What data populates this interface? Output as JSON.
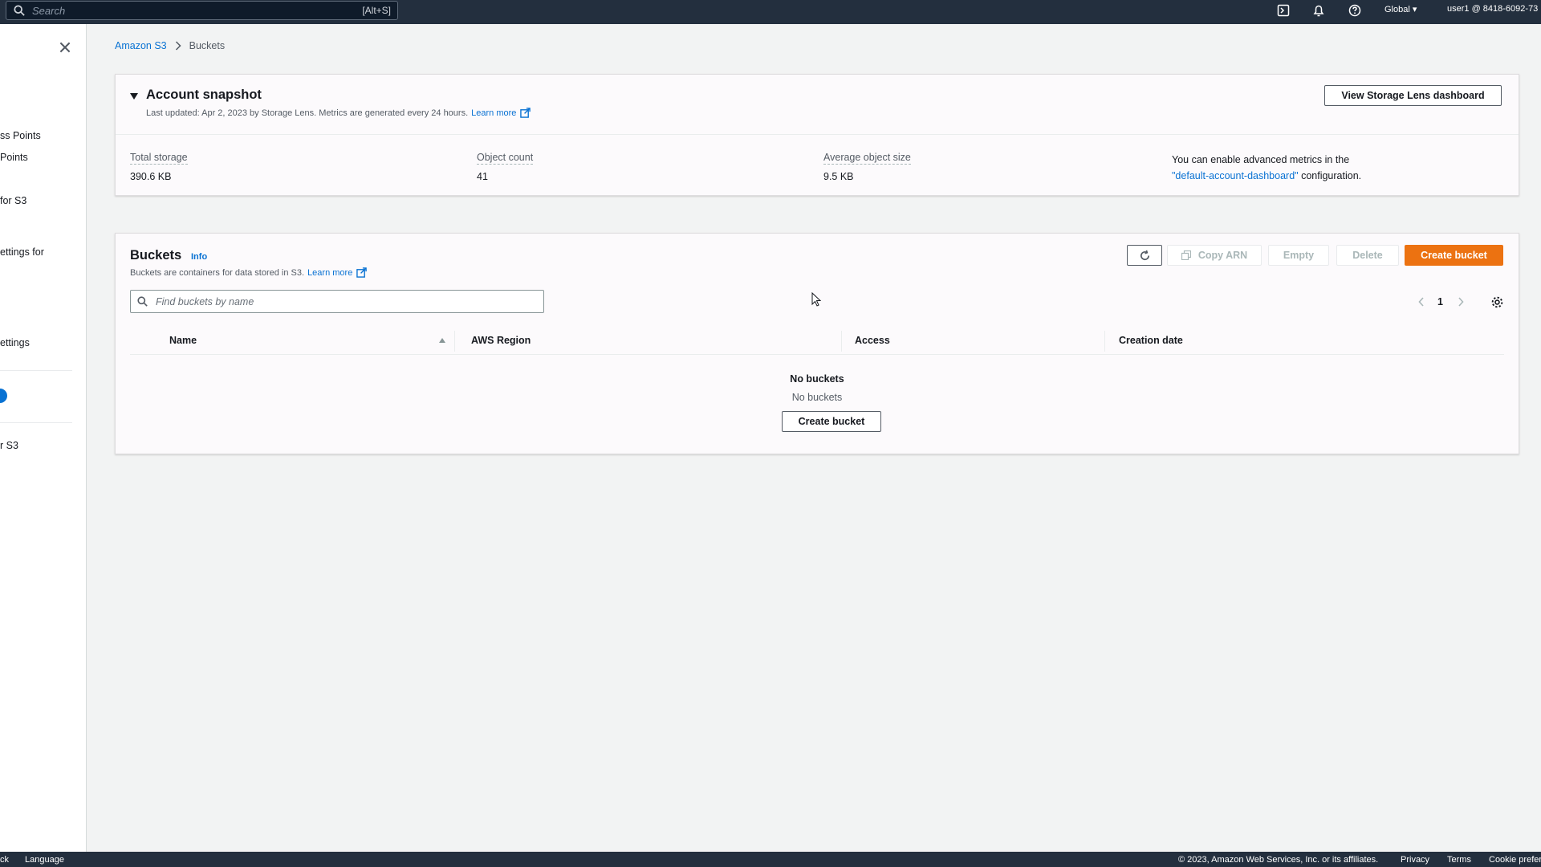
{
  "topnav": {
    "search_placeholder": "Search",
    "search_shortcut": "[Alt+S]",
    "region": "Global ▾",
    "user": "user1 @ 8418-6092-73"
  },
  "sidenav": {
    "items": [
      "ss Points",
      "Points",
      "for S3",
      "ettings for",
      "ettings",
      "r S3"
    ]
  },
  "breadcrumb": {
    "root": "Amazon S3",
    "current": "Buckets"
  },
  "snapshot": {
    "title": "Account snapshot",
    "subtitle": "Last updated: Apr 2, 2023 by Storage Lens. Metrics are generated every 24 hours.",
    "learn_more": "Learn more",
    "view_button": "View Storage Lens dashboard",
    "metrics": [
      {
        "label": "Total storage",
        "value": "390.6 KB"
      },
      {
        "label": "Object count",
        "value": "41"
      },
      {
        "label": "Average object size",
        "value": "9.5 KB"
      }
    ],
    "advanced_prefix": "You can enable advanced metrics in the",
    "advanced_link": "\"default-account-dashboard\"",
    "advanced_suffix": " configuration."
  },
  "buckets": {
    "title": "Buckets",
    "info": "Info",
    "subtitle": "Buckets are containers for data stored in S3.",
    "learn_more": "Learn more",
    "buttons": {
      "copy_arn": "Copy ARN",
      "empty": "Empty",
      "delete": "Delete",
      "create": "Create bucket"
    },
    "search_placeholder": "Find buckets by name",
    "page": "1",
    "columns": [
      "Name",
      "AWS Region",
      "Access",
      "Creation date"
    ],
    "empty_title": "No buckets",
    "empty_desc": "No buckets",
    "empty_button": "Create bucket"
  },
  "footer": {
    "feedback": "ck",
    "language": "Language",
    "copyright": "© 2023, Amazon Web Services, Inc. or its affiliates.",
    "privacy": "Privacy",
    "terms": "Terms",
    "cookies": "Cookie prefer"
  },
  "colors": {
    "nav_bg": "#232f3e",
    "primary": "#ec7211",
    "link": "#0972d3"
  }
}
